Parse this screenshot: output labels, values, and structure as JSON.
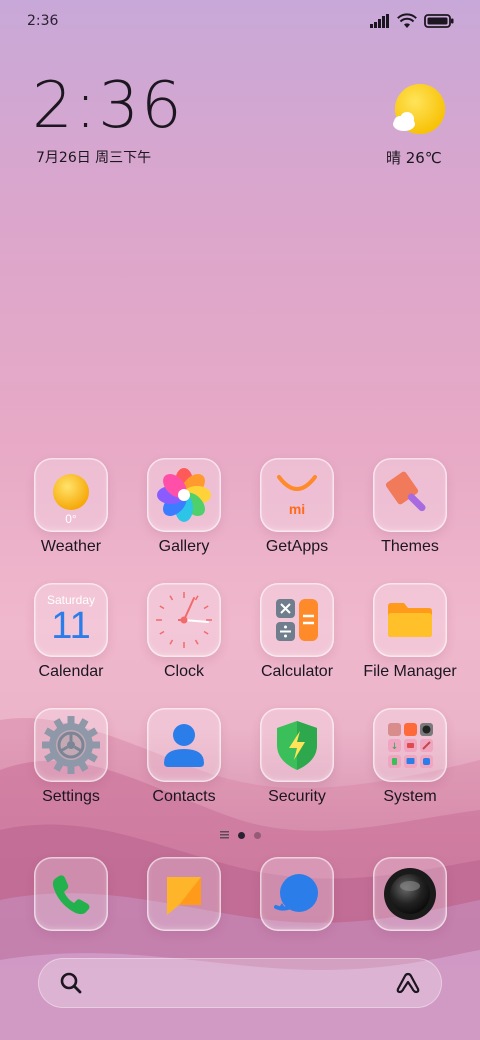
{
  "status_bar": {
    "time": "2:36"
  },
  "clock": {
    "time": "2:36",
    "date": "7月26日 周三下午"
  },
  "weather_widget": {
    "text": "晴 26℃"
  },
  "apps": {
    "weather": {
      "label": "Weather",
      "temp": "0°"
    },
    "gallery": {
      "label": "Gallery"
    },
    "getapps": {
      "label": "GetApps",
      "logo": "mi"
    },
    "themes": {
      "label": "Themes"
    },
    "calendar": {
      "label": "Calendar",
      "weekday": "Saturday",
      "day": "11"
    },
    "clock": {
      "label": "Clock"
    },
    "calculator": {
      "label": "Calculator"
    },
    "file_manager": {
      "label": "File Manager"
    },
    "settings": {
      "label": "Settings"
    },
    "contacts": {
      "label": "Contacts"
    },
    "security": {
      "label": "Security"
    },
    "system": {
      "label": "System"
    }
  },
  "dock": [
    "phone-icon",
    "messages-icon",
    "browser-icon",
    "camera-icon"
  ],
  "page_indicator": {
    "pages": 2,
    "active": 1
  },
  "colors": {
    "accent_orange": "#ff8a2a",
    "wallpaper_pink": "#e7a9c6",
    "security_green": "#3bbf5a",
    "contacts_blue": "#2b7de9"
  }
}
